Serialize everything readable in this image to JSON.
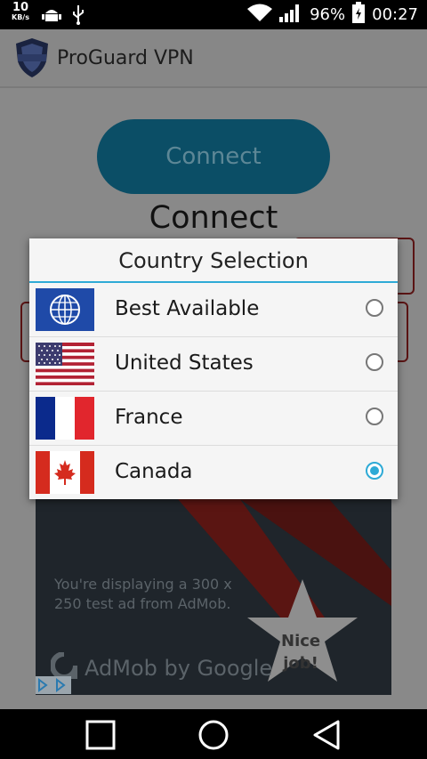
{
  "status_bar": {
    "speed_value": "10",
    "speed_unit": "KB/s",
    "battery": "96%",
    "time": "00:27"
  },
  "app_bar": {
    "title": "ProGuard VPN"
  },
  "main": {
    "connect_button": "Connect",
    "connect_heading": "Connect"
  },
  "dialog": {
    "title": "Country Selection",
    "options": [
      {
        "label": "Best Available",
        "selected": false,
        "flag": "globe-flag-icon"
      },
      {
        "label": "United States",
        "selected": false,
        "flag": "us-flag-icon"
      },
      {
        "label": "France",
        "selected": false,
        "flag": "france-flag-icon"
      },
      {
        "label": "Canada",
        "selected": true,
        "flag": "canada-flag-icon"
      }
    ],
    "accent_color": "#2eaad6"
  },
  "ad": {
    "text": "You're displaying a 300 x 250 test ad from AdMob.",
    "brand": "AdMob by Google",
    "badge_line1": "Nice",
    "badge_line2": "job!"
  }
}
